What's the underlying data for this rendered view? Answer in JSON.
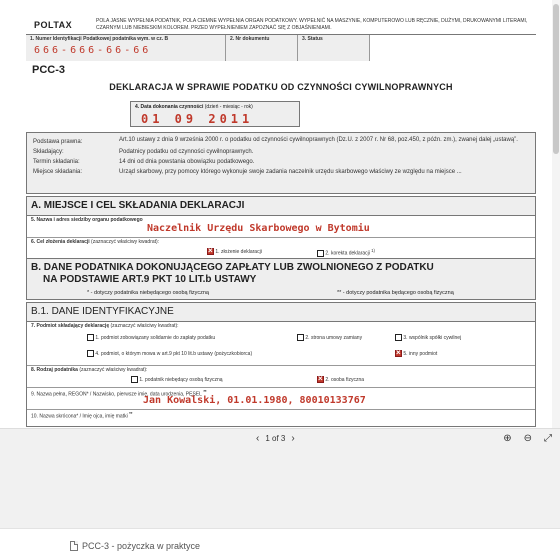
{
  "doc": {
    "brand": "POLTAX",
    "top_note": "POLA JASNE WYPEŁNIA PODATNIK, POLA CIEMNE WYPEŁNIA ORGAN PODATKOWY. WYPEŁNIĆ NA MASZYNIE, KOMPUTEROWO LUB RĘCZNIE, DUŻYMI, DRUKOWANYMI LITERAMI, CZARNYM LUB NIEBIESKIM KOLOREM. PRZED WYPEŁNIENIEM ZAPOZNAĆ SIĘ Z OBJAŚNIENIAMI.",
    "field1_label": "1. Numer Identyfikacji Podatkowej podatnika wym. w cz. B",
    "field1_value": "666-666-66-66",
    "field2_label": "2. Nr dokumentu",
    "field3_label": "3. Status",
    "form_code": "PCC-3",
    "title": "DEKLARACJA W SPRAWIE PODATKU OD CZYNNOŚCI CYWILNOPRAWNYCH",
    "date_label": "4. Data dokonania czynności",
    "date_hint": "(dzień - miesiąc - rok)",
    "date_value": "01 09 2011",
    "legal": {
      "basis_k": "Podstawa prawna:",
      "basis_v": "Art.10 ustawy z dnia 9 września 2000 r. o podatku od czynności cywilnoprawnych (Dz.U. z 2007 r. Nr 68, poz.450, z późn. zm.), zwanej dalej „ustawą”.",
      "filer_k": "Składający:",
      "filer_v": "Podatnicy podatku od czynności cywilnoprawnych.",
      "deadline_k": "Termin składania:",
      "deadline_v": "14 dni od dnia powstania obowiązku podatkowego.",
      "place_k": "Miejsce składania:",
      "place_v": "Urząd skarbowy, przy pomocy którego wykonuje swoje zadania naczelnik urzędu skarbowego właściwy ze względu na miejsce ..."
    },
    "sectionA": {
      "heading": "A. MIEJSCE I CEL SKŁADANIA DEKLARACJI",
      "f5_label": "5. Nazwa i adres siedziby organu podatkowego",
      "f5_value": "Naczelnik Urzędu Skarbowego w Bytomiu",
      "f6_label": "6. Cel złożenia deklaracji",
      "f6_hint": "(zaznaczyć właściwy kwadrat):",
      "opt1": "1. złożenie deklaracji",
      "opt2": "2. korekta deklaracji",
      "opt2_sup": "1)"
    },
    "sectionB": {
      "heading_line1": "B. DANE PODATNIKA DOKONUJĄCEGO ZAPŁATY LUB ZWOLNIONEGO Z PODATKU",
      "heading_line2": "NA PODSTAWIE ART.9 PKT 10 LIT.b USTAWY",
      "note1": "* - dotyczy podatnika niebędącego osobą fizyczną",
      "note2": "** - dotyczy podatnika będącego osobą fizyczną"
    },
    "sectionB1": {
      "heading": "B.1. DANE IDENTYFIKACYJNE",
      "f7_label": "7. Podmiot składający deklarację",
      "f7_hint": "(zaznaczyć właściwy kwadrat):",
      "f7_o1": "1. podmiot zobowiązany solidarnie do zapłaty podatku",
      "f7_o2": "2. strona umowy zamiany",
      "f7_o3": "3. wspólnik spółki cywilnej",
      "f7_o4": "4. podmiot, o którym mowa w art.9 pkt 10 lit.b ustawy (pożyczkobiorca)",
      "f7_o5": "5. inny podmiot",
      "f8_label": "8. Rodzaj podatnika",
      "f8_hint": "(zaznaczyć właściwy kwadrat):",
      "f8_o1": "1. podatnik niebędący osobą fizyczną",
      "f8_o2": "2. osoba fizyczna",
      "f9_label": "9. Nazwa pełna, REGON* / Nazwisko, pierwsze imię, data urodzenia, PESEL",
      "f9_sup": "**",
      "f9_value": "Jan Kowalski, 01.01.1980, 80010133767",
      "f10_label": "10. Nazwa skrócona* / Imię ojca, imię matki",
      "f10_sup": "**"
    }
  },
  "toolbar": {
    "page_indicator": "1 of 3",
    "prev_label": "‹",
    "next_label": "›",
    "zoom_in_label": "⊕",
    "zoom_out_label": "⊖",
    "fullscreen_label": "⤢"
  },
  "footer": {
    "file_name": "PCC-3 - pożyczka w praktyce"
  },
  "colors": {
    "filled_text": "#c0392b",
    "panel_gray": "#eeeeee"
  }
}
